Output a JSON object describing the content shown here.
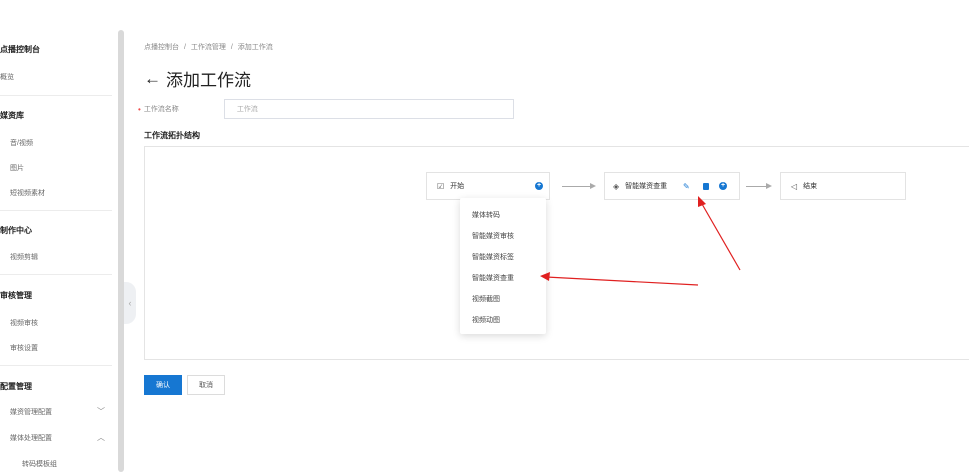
{
  "sidebar": {
    "title": "点播控制台",
    "overview": "概览",
    "media_section": "媒资库",
    "media_items": [
      "音/视频",
      "图片",
      "短视频素材"
    ],
    "production_section": "制作中心",
    "production_items": [
      "视频剪辑"
    ],
    "review_section": "审核管理",
    "review_items": [
      "视频审核",
      "审核设置"
    ],
    "config_section": "配置管理",
    "config_items": [
      "媒资管理配置",
      "媒体处理配置"
    ],
    "config_sub_items": [
      "转码模板组"
    ]
  },
  "breadcrumb": [
    "点播控制台",
    "/",
    "工作流管理",
    "/",
    "添加工作流"
  ],
  "page_title": "添加工作流",
  "form": {
    "name_label": "工作流名称",
    "name_placeholder": "工作流"
  },
  "topology_title": "工作流拓扑结构",
  "nodes": {
    "start_label": "开始",
    "middle_label": "智能媒资查重",
    "end_label": "结束"
  },
  "dropdown_items": [
    "媒体转码",
    "智能媒资审核",
    "智能媒资标签",
    "智能媒资查重",
    "视频截图",
    "视频动图"
  ],
  "buttons": {
    "confirm": "确认",
    "cancel": "取消"
  },
  "colors": {
    "primary": "#1677d2",
    "annotation": "#e02020"
  }
}
